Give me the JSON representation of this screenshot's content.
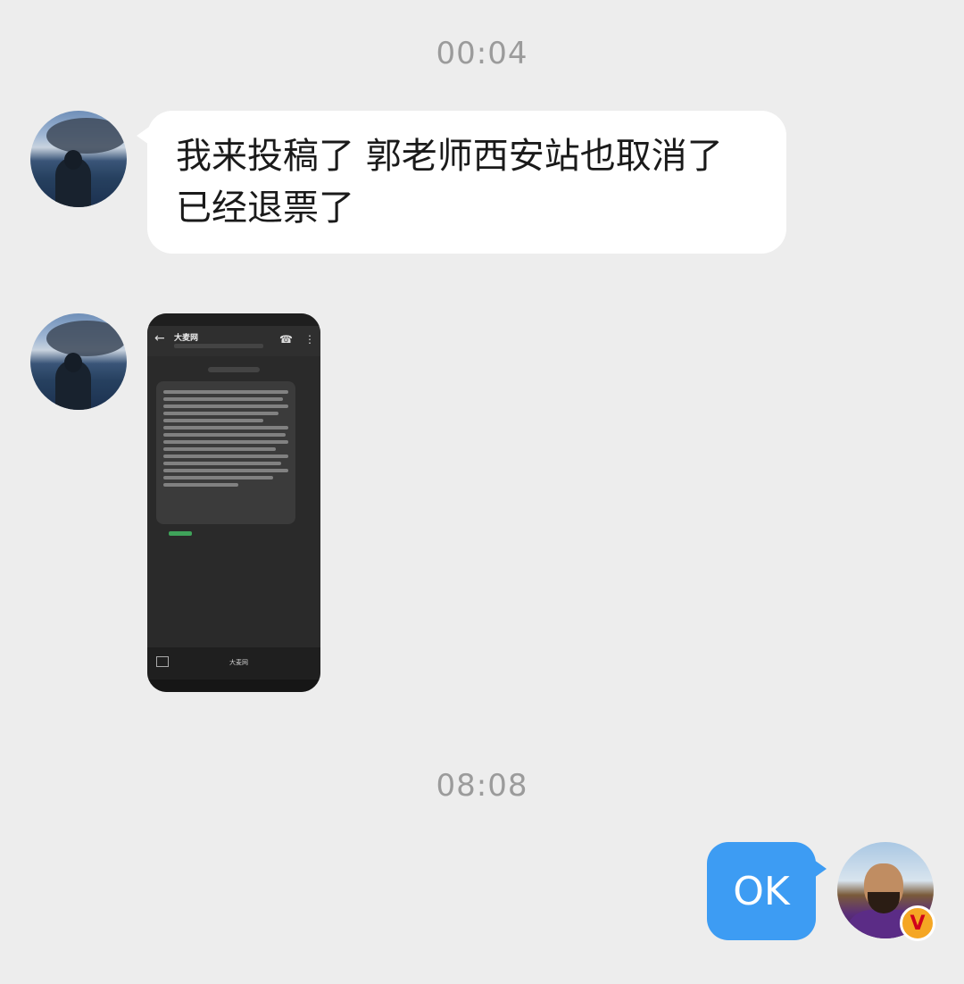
{
  "conversation": {
    "timestamps": [
      "00:04",
      "08:08"
    ],
    "messages": [
      {
        "direction": "incoming",
        "type": "text",
        "text": "我来投稿了 郭老师西安站也取消了已经退票了"
      },
      {
        "direction": "incoming",
        "type": "image",
        "image": {
          "sender_name": "大麦网",
          "brand_label": "大麦网"
        }
      },
      {
        "direction": "outgoing",
        "type": "text",
        "text": "OK"
      }
    ]
  },
  "badges": {
    "verified_label": "V"
  },
  "colors": {
    "background": "#ededed",
    "incoming_bubble": "#ffffff",
    "outgoing_bubble": "#3d9cf3",
    "timestamp": "#9b9b9b",
    "badge": "#f5a623"
  }
}
